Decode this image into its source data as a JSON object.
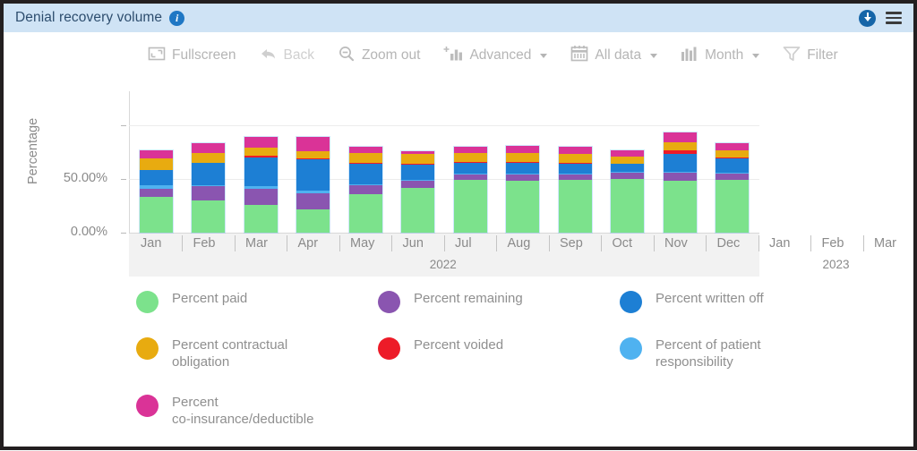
{
  "window": {
    "title": "Denial recovery volume",
    "info_icon": "info-icon",
    "download_icon": "download-icon",
    "menu_icon": "hamburger-menu-icon",
    "titlebar_color": "#cfe3f5",
    "title_text_color": "#2d4d6e"
  },
  "toolbar": {
    "items": [
      {
        "label": "Fullscreen",
        "icon": "fullscreen-icon",
        "disabled": false,
        "caret": false
      },
      {
        "label": "Back",
        "icon": "back-arrow-icon",
        "disabled": true,
        "caret": false
      },
      {
        "label": "Zoom out",
        "icon": "zoom-out-icon",
        "disabled": false,
        "caret": false
      },
      {
        "label": "Advanced",
        "icon": "advanced-chart-icon",
        "disabled": false,
        "caret": true
      },
      {
        "label": "All data",
        "icon": "calendar-icon",
        "disabled": false,
        "caret": true
      },
      {
        "label": "Month",
        "icon": "bar-chart-icon",
        "disabled": false,
        "caret": true
      },
      {
        "label": "Filter",
        "icon": "funnel-icon",
        "disabled": false,
        "caret": false
      }
    ]
  },
  "chart_data": {
    "type": "bar",
    "stacked": true,
    "title": "Denial recovery volume",
    "xlabel": "",
    "ylabel": "Percentage",
    "ylim": [
      0,
      100
    ],
    "ytick_labels": [
      "0.00%",
      "50.00%"
    ],
    "ytick_values": [
      0,
      50
    ],
    "grid": true,
    "legend_position": "bottom",
    "categories": [
      "Jan",
      "Feb",
      "Mar",
      "Apr",
      "May",
      "Jun",
      "Jul",
      "Aug",
      "Sep",
      "Oct",
      "Nov",
      "Dec"
    ],
    "category_groups": [
      {
        "label": "2022",
        "categories": [
          "Jan",
          "Feb",
          "Mar",
          "Apr",
          "May",
          "Jun",
          "Jul",
          "Aug",
          "Sep",
          "Oct",
          "Nov",
          "Dec"
        ]
      },
      {
        "label": "2023",
        "categories": [
          "Jan",
          "Feb",
          "Mar"
        ]
      }
    ],
    "empty_categories": [
      "Jan",
      "Feb",
      "Mar"
    ],
    "series": [
      {
        "name": "Percent paid",
        "color": "#7ce28c",
        "values": [
          33,
          30,
          26,
          22,
          36,
          42,
          49,
          48,
          49,
          50,
          48,
          49
        ]
      },
      {
        "name": "Percent remaining",
        "color": "#8a55b0",
        "values": [
          8,
          13,
          15,
          15,
          8,
          6,
          5,
          6,
          5,
          6,
          8,
          6
        ]
      },
      {
        "name": "Percent of patient responsibility",
        "color": "#4fb2f0",
        "values": [
          3,
          1,
          2,
          2,
          1,
          1,
          1,
          1,
          1,
          1,
          1,
          1
        ]
      },
      {
        "name": "Percent written off",
        "color": "#1d7fd4",
        "values": [
          14,
          21,
          27,
          29,
          19,
          14,
          10,
          10,
          9,
          7,
          16,
          13
        ]
      },
      {
        "name": "Percent voided",
        "color": "#ed1b28",
        "values": [
          0,
          0,
          2,
          1,
          1,
          1,
          1,
          1,
          1,
          0,
          4,
          1
        ]
      },
      {
        "name": "Percent contractual obligation",
        "color": "#e8ab10",
        "values": [
          11,
          9,
          7,
          7,
          9,
          9,
          8,
          8,
          8,
          7,
          7,
          7
        ]
      },
      {
        "name": "Percent co-insurance/deductible",
        "color": "#da3397",
        "values": [
          8,
          9,
          10,
          13,
          6,
          3,
          6,
          7,
          7,
          6,
          9,
          6
        ]
      }
    ]
  },
  "legend": {
    "entries": [
      {
        "label": "Percent paid",
        "color": "#7ce28c"
      },
      {
        "label": "Percent remaining",
        "color": "#8a55b0"
      },
      {
        "label": "Percent written off",
        "color": "#1d7fd4"
      },
      {
        "label": "Percent contractual\nobligation",
        "color": "#e8ab10"
      },
      {
        "label": "Percent voided",
        "color": "#ed1b28"
      },
      {
        "label": "Percent of patient\nresponsibility",
        "color": "#4fb2f0"
      },
      {
        "label": "Percent\nco-insurance/deductible",
        "color": "#da3397"
      }
    ]
  }
}
